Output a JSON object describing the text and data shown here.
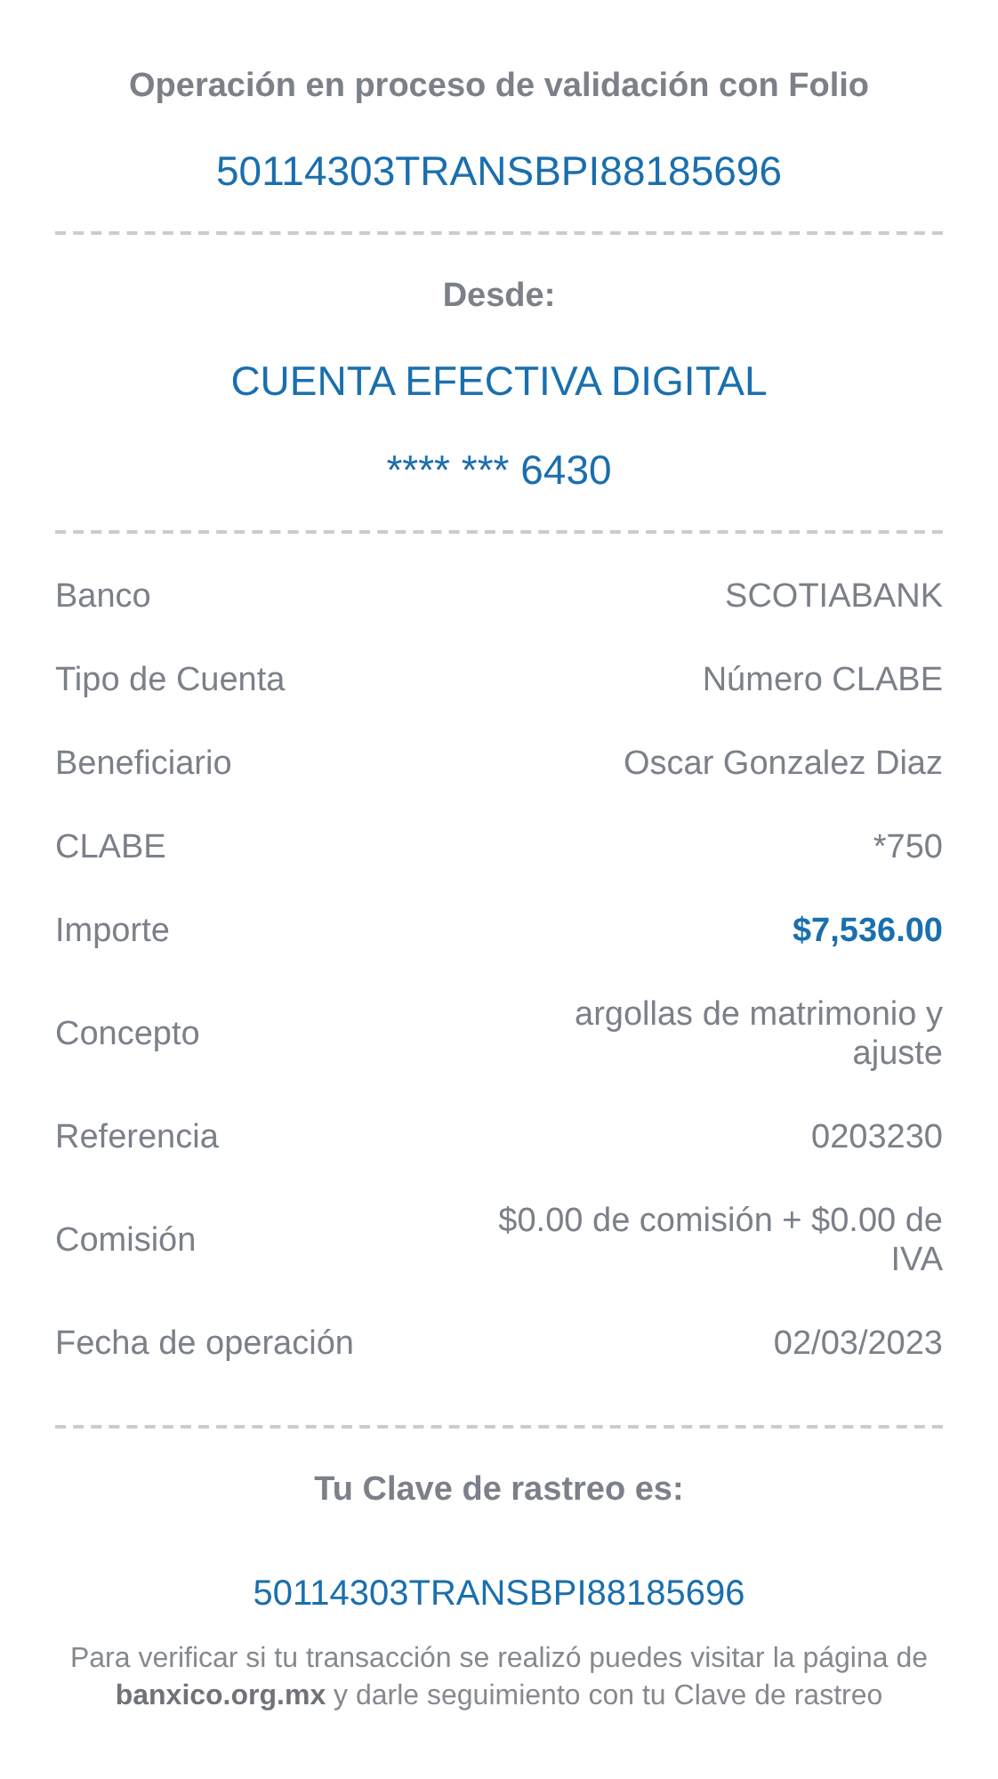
{
  "header": {
    "title": "Operación en proceso de validación con Folio",
    "folio": "50114303TRANSBPI88185696"
  },
  "origin": {
    "label": "Desde:",
    "account_name": "CUENTA EFECTIVA DIGITAL",
    "account_number": "**** *** 6430"
  },
  "details": [
    {
      "label": "Banco",
      "value": "SCOTIABANK",
      "highlight": false
    },
    {
      "label": "Tipo de Cuenta",
      "value": "Número CLABE",
      "highlight": false
    },
    {
      "label": "Beneficiario",
      "value": "Oscar Gonzalez Diaz",
      "highlight": false
    },
    {
      "label": "CLABE",
      "value": "*750",
      "highlight": false
    },
    {
      "label": "Importe",
      "value": "$7,536.00",
      "highlight": true
    },
    {
      "label": "Concepto",
      "value": "argollas de matrimonio y ajuste",
      "highlight": false
    },
    {
      "label": "Referencia",
      "value": "0203230",
      "highlight": false
    },
    {
      "label": "Comisión",
      "value": "$0.00 de comisión + $0.00 de IVA",
      "highlight": false
    },
    {
      "label": "Fecha de operación",
      "value": "02/03/2023",
      "highlight": false
    }
  ],
  "tracking": {
    "label": "Tu Clave de rastreo es:",
    "code": "50114303TRANSBPI88185696",
    "note": "Para verificar si tu transacción se realizó puedes visitar la página de **banxico.org.mx** y darle seguimiento con tu Clave de rastreo"
  }
}
